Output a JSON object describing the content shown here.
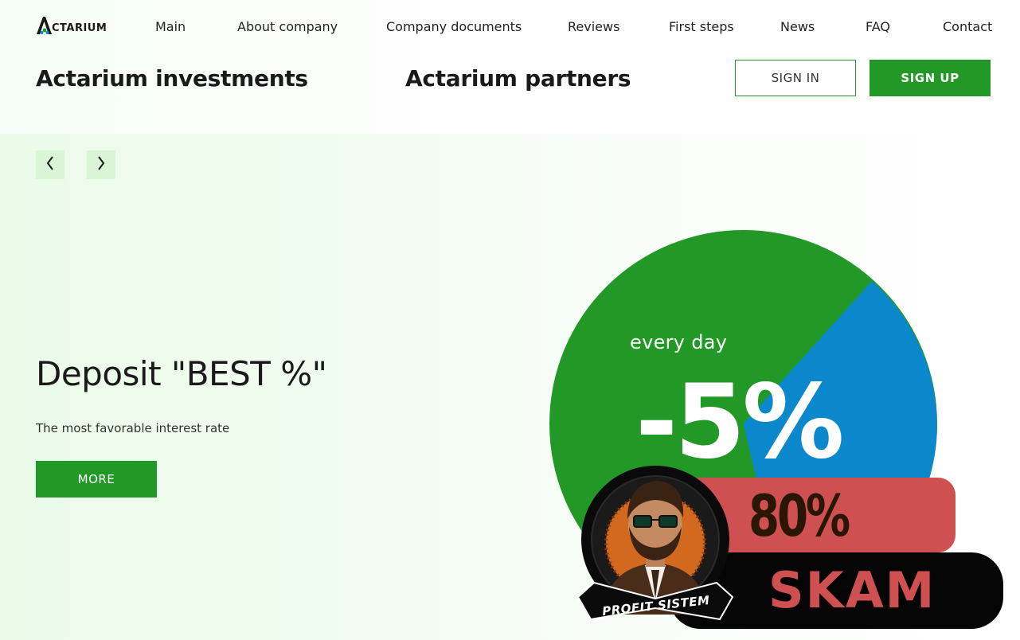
{
  "logo": {
    "text": "CTARIUM",
    "mark_letter": "A"
  },
  "nav": {
    "items": [
      {
        "label": "Main"
      },
      {
        "label": "About company"
      },
      {
        "label": "Company documents"
      },
      {
        "label": "Reviews"
      },
      {
        "label": "First steps"
      },
      {
        "label": "News"
      },
      {
        "label": "FAQ"
      },
      {
        "label": "Contact"
      }
    ]
  },
  "brands": {
    "investments": "Actarium investments",
    "partners": "Actarium partners"
  },
  "auth": {
    "sign_in": "SIGN IN",
    "sign_up": "SIGN UP"
  },
  "slider": {
    "prev_icon": "chevron-left-icon",
    "next_icon": "chevron-right-icon"
  },
  "hero": {
    "title": "Deposit \"BEST %\"",
    "subtitle": "The most favorable interest rate",
    "more_label": "MORE"
  },
  "pie": {
    "label_small": "every day",
    "label_big": "-5%",
    "colors": {
      "green": "#229926",
      "blue": "#0b88cc"
    }
  },
  "overlay": {
    "percent": "80%",
    "verdict": "SKAM",
    "badge_text": "PROFIT SISTEM",
    "colors": {
      "red": "#cf5050",
      "black": "#050505"
    }
  },
  "colors": {
    "accent": "#229926",
    "hero_bg": "#eafbe8",
    "arrow_bg": "#d9f5d6"
  }
}
